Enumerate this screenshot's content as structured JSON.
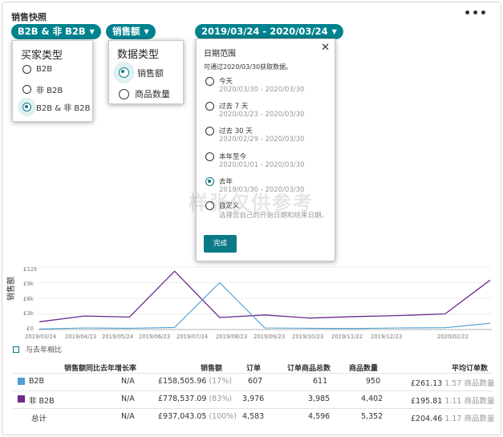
{
  "widget": {
    "title": "销售快照",
    "more_icon": "more-icon"
  },
  "filters": {
    "buyer_pill": "B2B & 非 B2B",
    "metric_pill": "销售额",
    "date_pill": "2019/03/24 - 2020/03/24",
    "pill_color": "#00838f"
  },
  "buyer_menu": {
    "heading": "买家类型",
    "options": [
      "B2B",
      "非 B2B",
      "B2B & 非 B2B"
    ],
    "selected": "B2B & 非 B2B"
  },
  "data_menu": {
    "heading": "数据类型",
    "options": [
      "销售额",
      "商品数量"
    ],
    "selected": "销售额"
  },
  "date_menu": {
    "heading": "日期范围",
    "note": "可通过2020/03/30获取数据。",
    "options": [
      {
        "label": "今天",
        "range": "2020/03/30 - 2020/03/30"
      },
      {
        "label": "过去 7 天",
        "range": "2020/03/23 - 2020/03/30"
      },
      {
        "label": "过去 30 天",
        "range": "2020/02/29 - 2020/03/30"
      },
      {
        "label": "本年至今",
        "range": "2020/01/01 - 2020/03/30"
      },
      {
        "label": "去年",
        "range": "2019/03/30 - 2020/03/30"
      },
      {
        "label": "自定义",
        "range": "选择您自己的开始日期和结束日期。"
      }
    ],
    "selected": "去年",
    "done_label": "完成",
    "close_icon": "close-icon"
  },
  "watermark": "样张仅供参考",
  "chart": {
    "ylabel": "销售额",
    "yticks": [
      "£12k",
      "£9k",
      "£6k",
      "£3k",
      "£0"
    ],
    "xticks": [
      "2019/03/24",
      "2019/04/23",
      "2019/05/24",
      "2019/06/23",
      "2019/07/24",
      "2019/08/23",
      "2019/09/23",
      "2019/10/23",
      "2019/11/22",
      "2019/12/23",
      "2020/02/22"
    ],
    "b2b_color": "#4a9fd5",
    "nonb2b_color": "#6b2a8c"
  },
  "chart_data": {
    "type": "line",
    "ylabel": "销售额",
    "ylim": [
      0,
      12000
    ],
    "x": [
      "2019/03/24",
      "2019/04/23",
      "2019/05/24",
      "2019/06/23",
      "2019/07/24",
      "2019/08/23",
      "2019/09/23",
      "2019/10/23",
      "2019/11/22",
      "2019/12/23",
      "2020/02/22"
    ],
    "series": [
      {
        "name": "B2B",
        "values": [
          100,
          300,
          250,
          400,
          9000,
          300,
          250,
          200,
          300,
          350,
          1200
        ]
      },
      {
        "name": "非 B2B",
        "values": [
          1500,
          2600,
          2400,
          11200,
          2300,
          2800,
          2200,
          2500,
          2700,
          3000,
          9500
        ]
      }
    ]
  },
  "compare": {
    "label": "与去年相比"
  },
  "table": {
    "headers": [
      "销售额同比去年增长率",
      "销售额",
      "订单",
      "订单商品总数",
      "商品数量",
      "平均订单数"
    ],
    "rows": [
      {
        "name": "B2B",
        "swatch": "#4a9fd5",
        "growth": "N/A",
        "sales": "£158,505.96",
        "sales_pct": "(17%)",
        "orders": "607",
        "order_items": "611",
        "units": "950",
        "avg": "£261.13",
        "avg_units": "1.57 商品数量"
      },
      {
        "name": "非 B2B",
        "swatch": "#6b2a8c",
        "growth": "N/A",
        "sales": "£778,537.09",
        "sales_pct": "(83%)",
        "orders": "3,976",
        "order_items": "3,985",
        "units": "4,402",
        "avg": "£195.81",
        "avg_units": "1.11 商品数量"
      },
      {
        "name": "总计",
        "swatch": "",
        "growth": "N/A",
        "sales": "£937,043.05",
        "sales_pct": "(100%)",
        "orders": "4,583",
        "order_items": "4,596",
        "units": "5,352",
        "avg": "£204.46",
        "avg_units": "1.17 商品数量"
      }
    ]
  }
}
